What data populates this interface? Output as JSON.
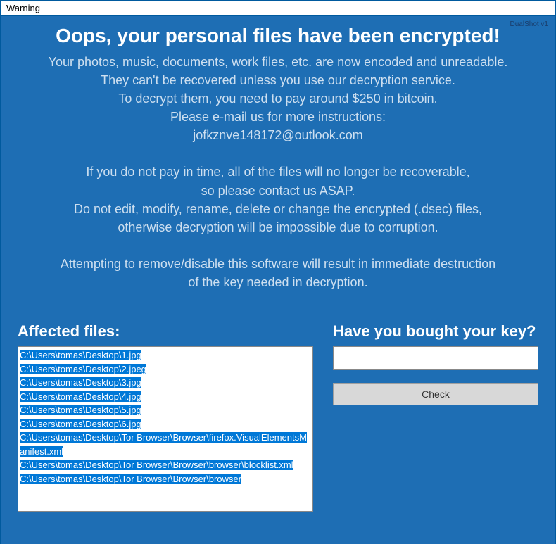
{
  "window": {
    "title": "Warning",
    "version": "DualShot v1"
  },
  "message": {
    "heading": "Oops, your personal files have been encrypted!",
    "paragraph1": "Your photos, music, documents, work files, etc. are now encoded and unreadable.\nThey can't be recovered unless you use our decryption service.\nTo decrypt them, you need to pay around $250 in bitcoin.\nPlease e-mail us for more instructions:\njofkznve148172@outlook.com",
    "paragraph2": "If you do not pay in time, all of the files will no longer be recoverable,\nso please contact us ASAP.\nDo not edit, modify, rename, delete or change the encrypted (.dsec) files,\notherwise decryption will be impossible due to corruption.",
    "paragraph3": "Attempting to remove/disable this software will result in immediate destruction\nof the key needed in decryption."
  },
  "affected": {
    "heading": "Affected files:",
    "files": [
      "C:\\Users\\tomas\\Desktop\\1.jpg",
      "C:\\Users\\tomas\\Desktop\\2.jpeg",
      "C:\\Users\\tomas\\Desktop\\3.jpg",
      "C:\\Users\\tomas\\Desktop\\4.jpg",
      "C:\\Users\\tomas\\Desktop\\5.jpg",
      "C:\\Users\\tomas\\Desktop\\6.jpg",
      "C:\\Users\\tomas\\Desktop\\Tor Browser\\Browser\\firefox.VisualElementsManifest.xml",
      "C:\\Users\\tomas\\Desktop\\Tor Browser\\Browser\\browser\\blocklist.xml",
      "C:\\Users\\tomas\\Desktop\\Tor Browser\\Browser\\browser"
    ]
  },
  "key": {
    "heading": "Have you bought your key?",
    "input_value": "",
    "button_label": "Check"
  }
}
